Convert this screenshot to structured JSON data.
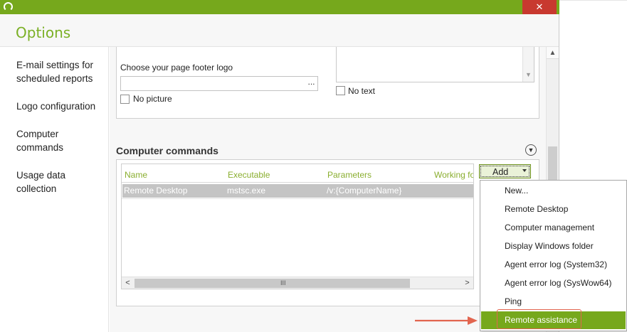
{
  "window": {
    "title": "Options",
    "close_glyph": "✕"
  },
  "sidebar": {
    "items": [
      {
        "label": "E-mail settings for scheduled reports"
      },
      {
        "label": "Logo configuration"
      },
      {
        "label": "Computer commands"
      },
      {
        "label": "Usage data collection"
      }
    ]
  },
  "logo_section": {
    "footer_logo_label": "Choose your page footer logo",
    "footer_logo_value": "",
    "browse_glyph": "...",
    "no_picture_label": "No picture",
    "no_picture_checked": false,
    "no_text_label": "No text",
    "no_text_checked": false
  },
  "commands_section": {
    "title": "Computer commands",
    "columns": [
      "Name",
      "Executable",
      "Parameters",
      "Working fo"
    ],
    "rows": [
      {
        "name": "Remote Desktop",
        "executable": "mstsc.exe",
        "parameters": "/v:{ComputerName}",
        "working_folder": ""
      }
    ],
    "add_button_label": "Add",
    "add_menu": [
      {
        "label": "New..."
      },
      {
        "label": "Remote Desktop"
      },
      {
        "label": "Computer management"
      },
      {
        "label": "Display Windows folder"
      },
      {
        "label": "Agent error log (System32)"
      },
      {
        "label": "Agent error log (SysWow64)"
      },
      {
        "label": "Ping"
      },
      {
        "label": "Remote assistance"
      }
    ],
    "selected_menu_item": "Remote assistance"
  },
  "icons": {
    "app": "app-logo-icon",
    "collapse": "chevron-down-circle-icon",
    "scroll_up": "chevron-up-icon",
    "scroll_down": "chevron-down-icon",
    "scroll_left": "chevron-left-icon",
    "scroll_right": "chevron-right-icon",
    "grip": "scroll-grip-icon"
  },
  "colors": {
    "accent": "#76a81c",
    "column_header": "#8aae2f",
    "close": "#c8392f",
    "selected_row": "#c4c4c4",
    "annotation": "#e2654f"
  }
}
